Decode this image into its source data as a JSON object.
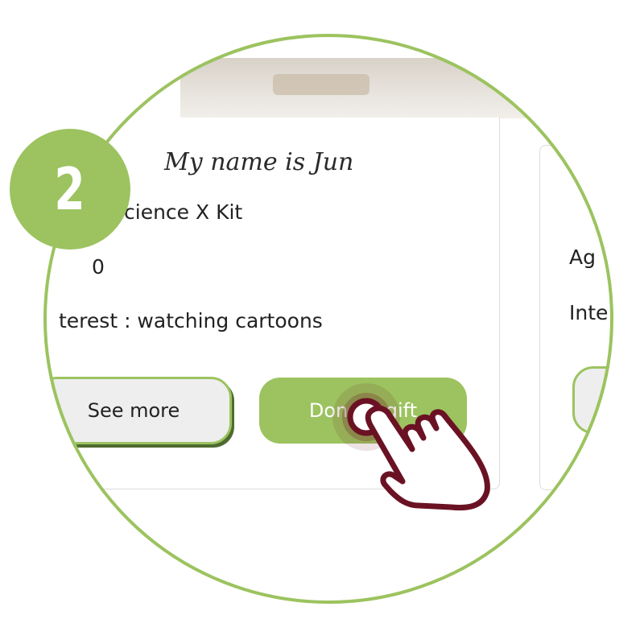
{
  "step_badge": {
    "number": "2"
  },
  "card": {
    "name_heading": "My name is Jun",
    "gift_line": "cience X Kit",
    "age_line": "0",
    "interest_line": "terest : watching cartoons",
    "see_more_label": "See more",
    "donate_label": "Donate gift"
  },
  "next_card": {
    "age_label": "Ag",
    "interest_label": "Inte"
  },
  "colors": {
    "accent_green": "#9cc35f",
    "button_shadow": "#4f6b31",
    "hand_outline": "#6a1223"
  },
  "icons": [
    "pointing-hand-icon",
    "tap-ripple-icon"
  ]
}
